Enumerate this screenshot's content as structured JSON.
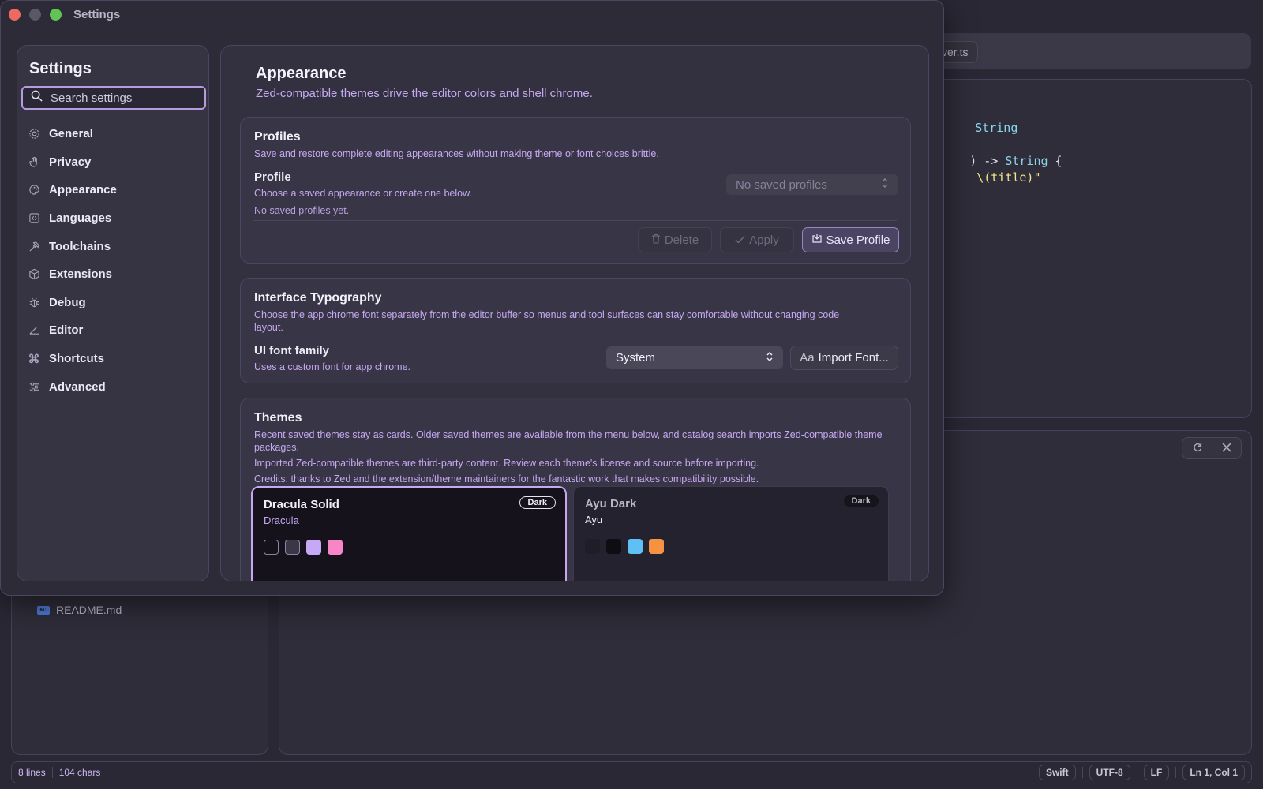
{
  "background": {
    "tab_label": "ver.ts",
    "code_lines": [
      {
        "text": "String",
        "color": "#8ad4e8"
      },
      {
        "text": ") -> String {",
        "color": "#e6e3f0"
      },
      {
        "text": " \\(title)\"",
        "color": "#f1e58a"
      }
    ],
    "terminal_buttons": [
      "refresh-icon",
      "close-icon"
    ],
    "file_item": {
      "icon": "markdown-icon",
      "label": "README.md"
    },
    "status_left": [
      "8 lines",
      "104 chars"
    ],
    "status_right": [
      "Swift",
      "UTF-8",
      "LF",
      "Ln 1, Col 1"
    ]
  },
  "window": {
    "title": "Settings",
    "traffic_lights": {
      "close": "#ed6a5e",
      "minimize": "#5a5866",
      "zoom": "#61c554"
    }
  },
  "sidebar": {
    "title": "Settings",
    "search_placeholder": "Search settings",
    "items": [
      {
        "label": "General",
        "icon": "gear-icon"
      },
      {
        "label": "Privacy",
        "icon": "hand-icon"
      },
      {
        "label": "Appearance",
        "icon": "palette-icon"
      },
      {
        "label": "Languages",
        "icon": "code-bracket-icon"
      },
      {
        "label": "Toolchains",
        "icon": "hammer-icon"
      },
      {
        "label": "Extensions",
        "icon": "cube-icon"
      },
      {
        "label": "Debug",
        "icon": "bug-icon"
      },
      {
        "label": "Editor",
        "icon": "angle-icon"
      },
      {
        "label": "Shortcuts",
        "icon": "command-icon"
      },
      {
        "label": "Advanced",
        "icon": "sliders-icon"
      }
    ]
  },
  "page": {
    "title": "Appearance",
    "subtitle": "Zed-compatible themes drive the editor colors and shell chrome."
  },
  "profiles": {
    "title": "Profiles",
    "description": "Save and restore complete editing appearances without making theme or font choices brittle.",
    "profile_label": "Profile",
    "profile_hint": "Choose a saved appearance or create one below.",
    "empty_note": "No saved profiles yet.",
    "select_value": "No saved profiles",
    "delete_label": "Delete",
    "apply_label": "Apply",
    "save_label": "Save Profile"
  },
  "typography": {
    "title": "Interface Typography",
    "description": "Choose the app chrome font separately from the editor buffer so menus and tool surfaces can stay comfortable without changing code layout.",
    "font_label": "UI font family",
    "font_hint": "Uses a custom font for app chrome.",
    "font_value": "System",
    "import_prefix": "Aa",
    "import_label": "Import Font..."
  },
  "themes": {
    "title": "Themes",
    "desc1": "Recent saved themes stay as cards. Older saved themes are available from the menu below, and catalog search imports Zed-compatible theme packages.",
    "desc2": "Imported Zed-compatible themes are third-party content. Review each theme's license and source before importing.",
    "desc3": "Credits: thanks to Zed and the extension/theme maintainers for the fantastic work that makes compatibility possible.",
    "cards": [
      {
        "name": "Dracula Solid",
        "family": "Dracula",
        "badge": "Dark",
        "selected": true,
        "swatches": [
          "#15121c",
          "#3a3848",
          "#c6a8f7",
          "#f886c6"
        ]
      },
      {
        "name": "Ayu Dark",
        "family": "Ayu",
        "badge": "Dark",
        "selected": false,
        "swatches": [
          "#1f1d27",
          "#0d0d12",
          "#5ec0f5",
          "#f59343"
        ]
      }
    ]
  }
}
